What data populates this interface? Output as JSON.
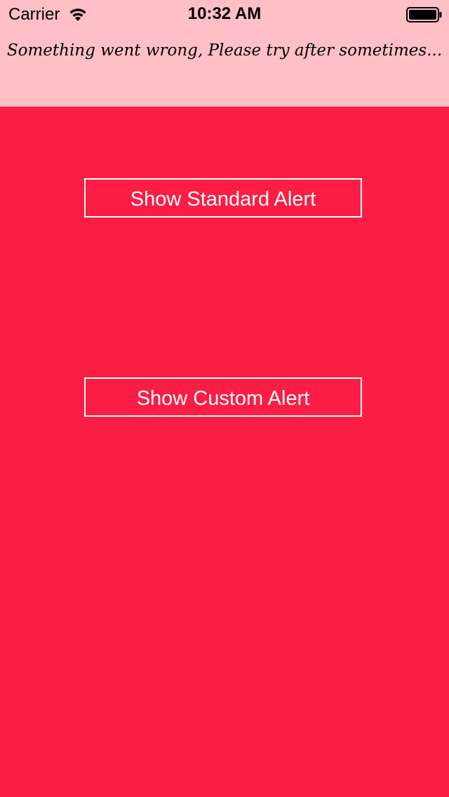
{
  "status_bar": {
    "carrier": "Carrier",
    "time": "10:32 AM",
    "wifi_icon": "wifi-icon",
    "battery_icon": "battery-icon"
  },
  "banner": {
    "message": "Something went wrong, Please try after sometimes..."
  },
  "buttons": {
    "standard_label": "Show Standard Alert",
    "custom_label": "Show Custom Alert"
  },
  "colors": {
    "banner_background": "#FEC0C6",
    "main_background": "#FC1D44",
    "button_border": "#FFFFFF",
    "button_text": "#FFFFFF"
  }
}
